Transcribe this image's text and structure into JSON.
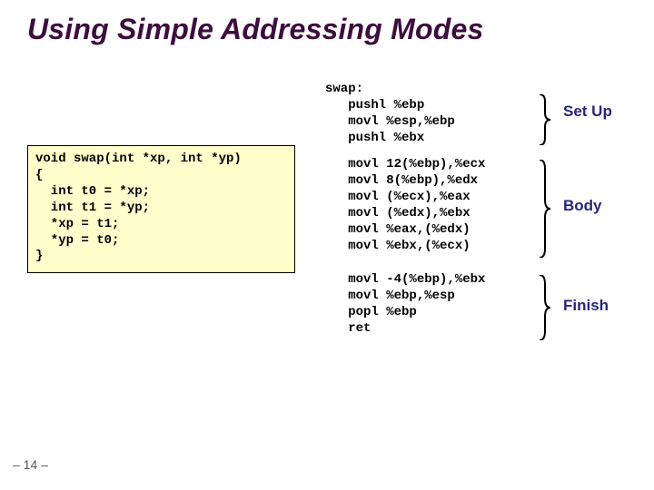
{
  "title": "Using Simple Addressing Modes",
  "c_code": "void swap(int *xp, int *yp)\n{\n  int t0 = *xp;\n  int t1 = *yp;\n  *xp = t1;\n  *yp = t0;\n}",
  "asm": {
    "setup": "swap:\n   pushl %ebp\n   movl %esp,%ebp\n   pushl %ebx",
    "body": "   movl 12(%ebp),%ecx\n   movl 8(%ebp),%edx\n   movl (%ecx),%eax\n   movl (%edx),%ebx\n   movl %eax,(%edx)\n   movl %ebx,(%ecx)",
    "finish": "   movl -4(%ebp),%ebx\n   movl %ebp,%esp\n   popl %ebp\n   ret"
  },
  "labels": {
    "setup": "Set\nUp",
    "body": "Body",
    "finish": "Finish"
  },
  "footer": "– 14 –"
}
